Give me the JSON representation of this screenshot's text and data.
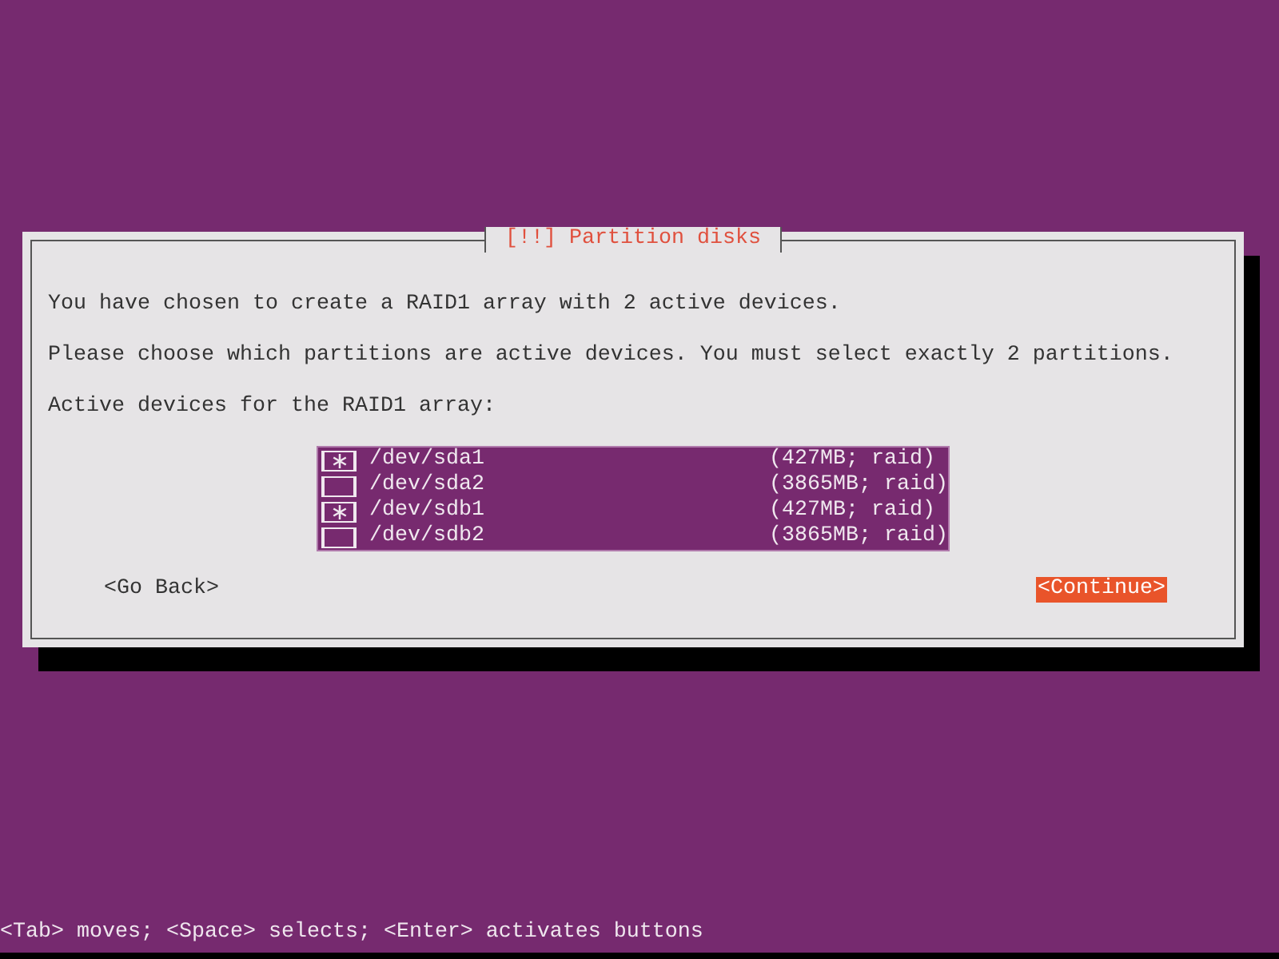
{
  "dialog": {
    "title": "[!!] Partition disks",
    "paragraphs": [
      "You have chosen to create a RAID1 array with 2 active devices.",
      "Please choose which partitions are active devices. You must select exactly 2 partitions.",
      "Active devices for the RAID1 array:"
    ],
    "devices": [
      {
        "name": "/dev/sda1",
        "size": "(427MB; raid)",
        "checked": true
      },
      {
        "name": "/dev/sda2",
        "size": "(3865MB; raid)",
        "checked": false
      },
      {
        "name": "/dev/sdb1",
        "size": "(427MB; raid)",
        "checked": true
      },
      {
        "name": "/dev/sdb2",
        "size": "(3865MB; raid)",
        "checked": false
      }
    ],
    "buttons": [
      {
        "label": "<Go Back>",
        "selected": false
      },
      {
        "label": "<Continue>",
        "selected": true
      }
    ]
  },
  "status_bar": "<Tab> moves; <Space> selects; <Enter> activates buttons"
}
